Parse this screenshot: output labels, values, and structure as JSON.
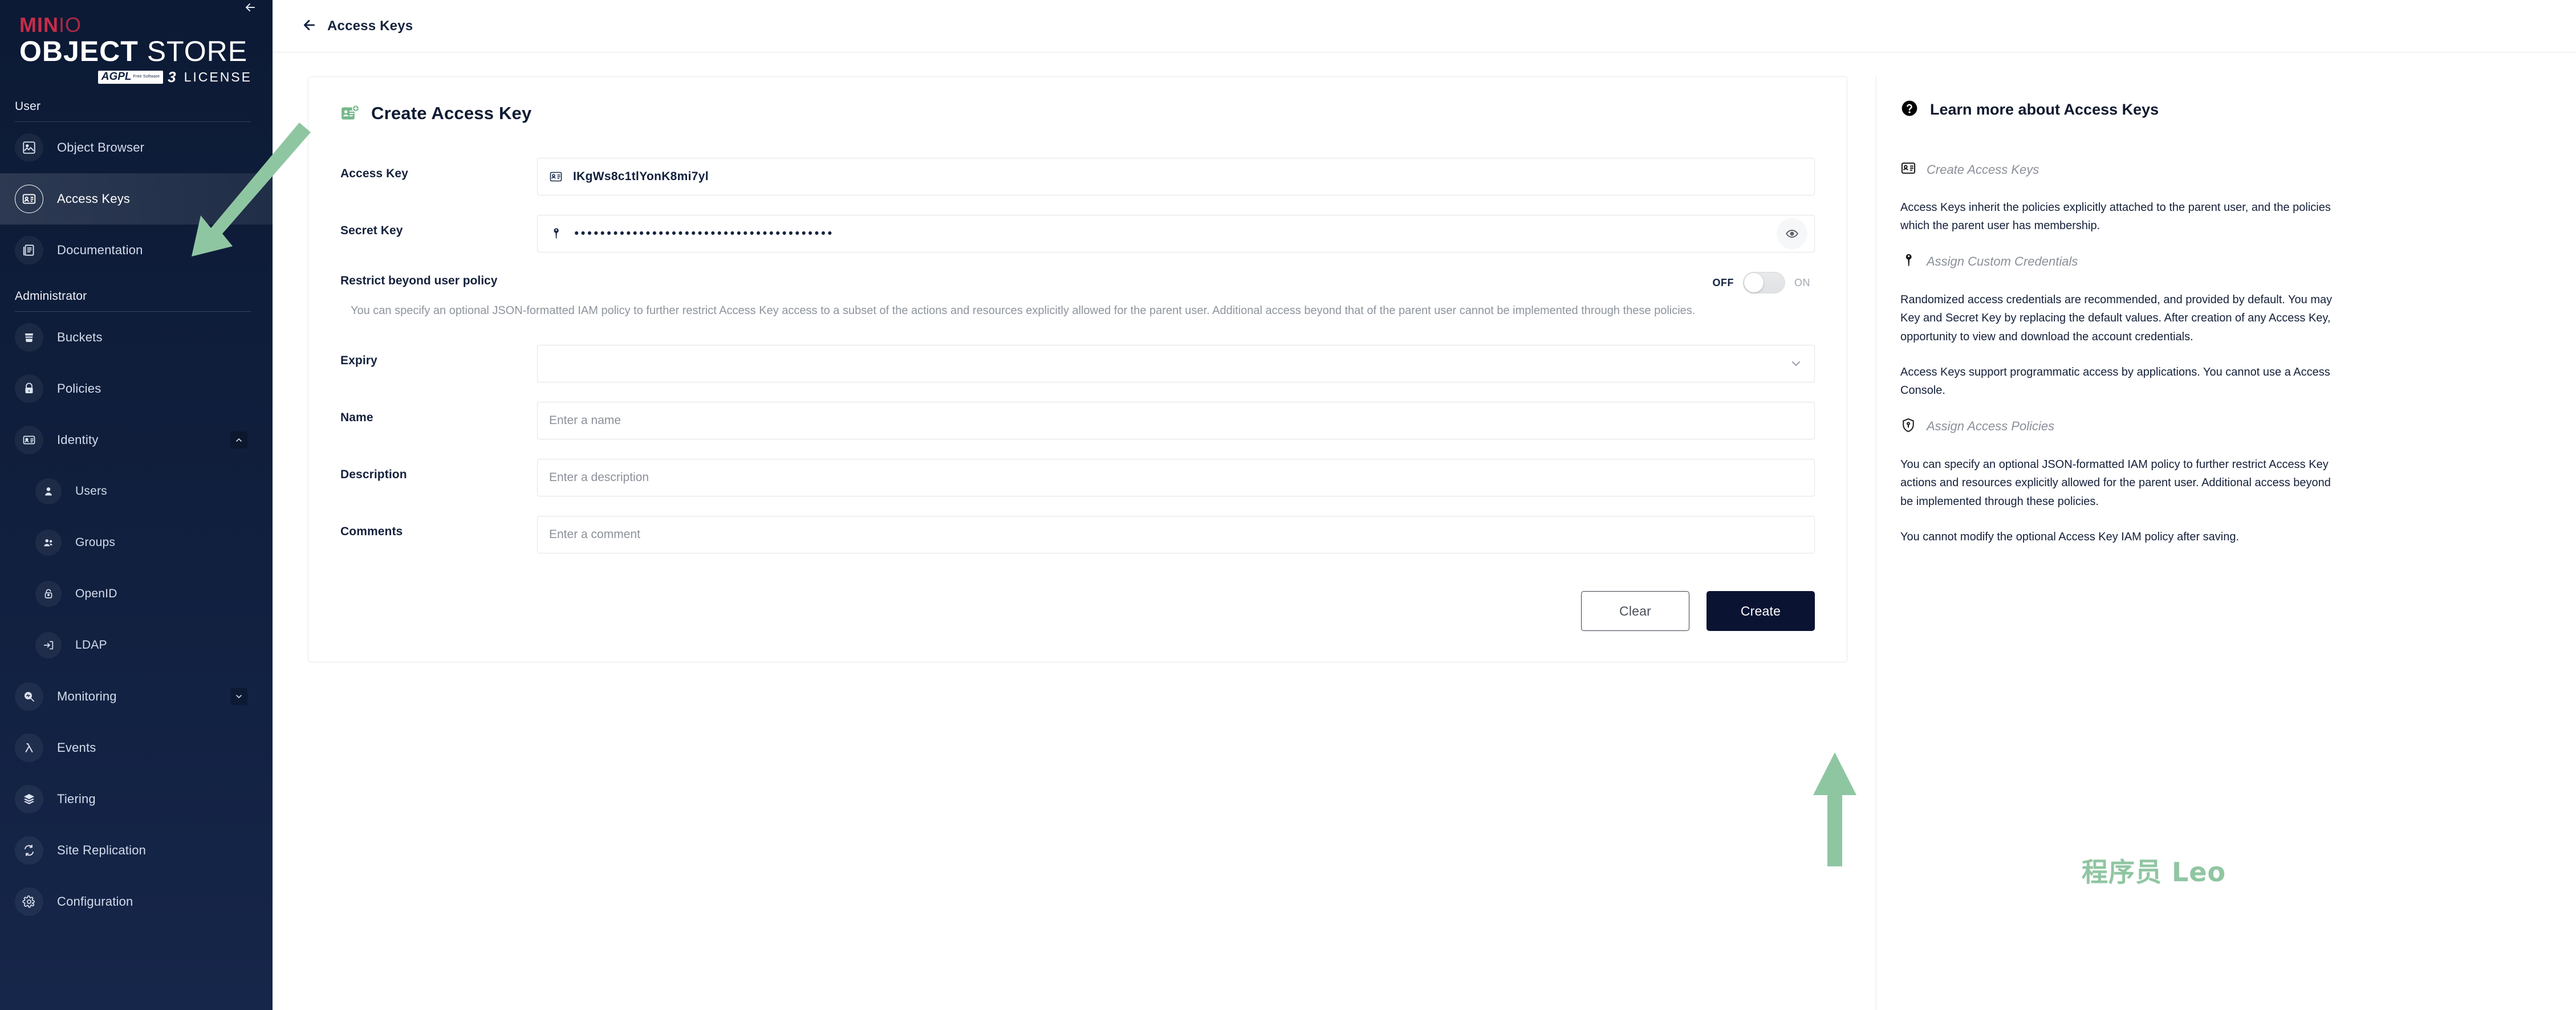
{
  "brand": {
    "minio_min": "MIN",
    "minio_io": "IO",
    "object": "OBJECT",
    "store": " STORE",
    "agpl": "AGPL",
    "agpl_sub": "Free Software",
    "agpl_version": "3",
    "license": "LICENSE",
    "collapse_icon": "collapse-sidebar-icon"
  },
  "sidebar": {
    "sections": [
      {
        "title": "User",
        "items": [
          {
            "label": "Object Browser",
            "icon": "object-browser-icon",
            "active": false
          },
          {
            "label": "Access Keys",
            "icon": "access-keys-icon",
            "active": true
          },
          {
            "label": "Documentation",
            "icon": "documentation-icon",
            "active": false
          }
        ]
      },
      {
        "title": "Administrator",
        "items": [
          {
            "label": "Buckets",
            "icon": "bucket-icon",
            "active": false
          },
          {
            "label": "Policies",
            "icon": "lock-icon",
            "active": false
          },
          {
            "label": "Identity",
            "icon": "identity-icon",
            "active": false,
            "expanded": true,
            "chevron": "chevron-up-icon"
          },
          {
            "label": "Users",
            "icon": "user-icon",
            "active": false,
            "sub": true
          },
          {
            "label": "Groups",
            "icon": "groups-icon",
            "active": false,
            "sub": true
          },
          {
            "label": "OpenID",
            "icon": "openid-lock-icon",
            "active": false,
            "sub": true
          },
          {
            "label": "LDAP",
            "icon": "ldap-login-icon",
            "active": false,
            "sub": true
          },
          {
            "label": "Monitoring",
            "icon": "monitoring-icon",
            "active": false,
            "expanded": false,
            "chevron": "chevron-down-icon"
          },
          {
            "label": "Events",
            "icon": "lambda-icon",
            "active": false
          },
          {
            "label": "Tiering",
            "icon": "layers-icon",
            "active": false
          },
          {
            "label": "Site Replication",
            "icon": "replication-icon",
            "active": false
          },
          {
            "label": "Configuration",
            "icon": "gear-icon",
            "active": false
          }
        ]
      }
    ]
  },
  "topbar": {
    "back_icon": "back-arrow-icon",
    "title": "Access Keys"
  },
  "form": {
    "icon": "create-access-key-icon",
    "title": "Create Access Key",
    "access_key": {
      "label": "Access Key",
      "value": "IKgWs8c1tlYonK8mi7yl",
      "icon": "access-key-id-icon"
    },
    "secret_key": {
      "label": "Secret Key",
      "value": "••••••••••••••••••••••••••••••••••••••••",
      "icon": "key-icon",
      "reveal_icon": "eye-icon"
    },
    "restrict": {
      "title": "Restrict beyond user policy",
      "description": "You can specify an optional JSON-formatted IAM policy to further restrict Access Key access to a subset of the actions and resources explicitly allowed for the parent user. Additional access beyond that of the parent user cannot be implemented through these policies.",
      "toggle_off_label": "OFF",
      "toggle_on_label": "ON",
      "toggle_state": "off"
    },
    "expiry": {
      "label": "Expiry",
      "value": "",
      "chevron_icon": "chevron-down-icon"
    },
    "name": {
      "label": "Name",
      "value": "",
      "placeholder": "Enter a name"
    },
    "description": {
      "label": "Description",
      "value": "",
      "placeholder": "Enter a description"
    },
    "comments": {
      "label": "Comments",
      "value": "",
      "placeholder": "Enter a comment"
    },
    "clear_label": "Clear",
    "create_label": "Create"
  },
  "info": {
    "icon": "help-circle-icon",
    "title": "Learn more about Access Keys",
    "sections": [
      {
        "icon": "access-key-id-icon",
        "title": "Create Access Keys",
        "paragraphs": [
          [
            "Access Keys inherit the policies explicitly attached to the parent user, and the policies",
            "which the parent user has membership."
          ]
        ]
      },
      {
        "icon": "key-icon",
        "title": "Assign Custom Credentials",
        "paragraphs": [
          [
            "Randomized access credentials are recommended, and provided by default. You may",
            "Key and Secret Key by replacing the default values. After creation of any Access Key,",
            "opportunity to view and download the account credentials."
          ],
          [
            "Access Keys support programmatic access by applications. You cannot use a Access",
            "Console."
          ]
        ]
      },
      {
        "icon": "shield-icon",
        "title": "Assign Access Policies",
        "paragraphs": [
          [
            "You can specify an optional JSON-formatted IAM policy to further restrict Access Key",
            "actions and resources explicitly allowed for the parent user. Additional access beyond",
            "be implemented through these policies."
          ],
          [
            "You cannot modify the optional Access Key IAM policy after saving."
          ]
        ]
      }
    ]
  },
  "watermark": {
    "text": "程序员 Leo"
  },
  "annotations": {
    "arrow_color": "#8fc6a2"
  }
}
